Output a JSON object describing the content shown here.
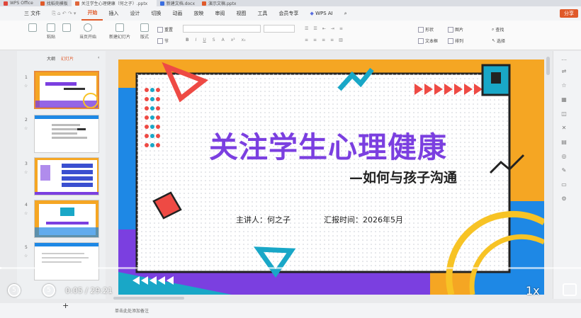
{
  "titlebar": {
    "tabs": [
      {
        "label": "WPS Office",
        "color": "#e0463a"
      },
      {
        "label": "找稻壳模板",
        "color": "#e05a2a"
      },
      {
        "label": "关注学生心理健康（何之子）.pptx",
        "color": "#e0663a"
      },
      {
        "label": "新建文档.docx",
        "color": "#3a6ee0"
      },
      {
        "label": "演示文稿.pptx",
        "color": "#e05a2a"
      }
    ]
  },
  "menu": {
    "file": "三 文件",
    "items": [
      "开始",
      "插入",
      "设计",
      "切换",
      "动画",
      "放映",
      "审阅",
      "视图",
      "工具",
      "会员专享"
    ],
    "wps_ai": "WPS AI",
    "share": "分享"
  },
  "ribbon": {
    "paste": "粘贴",
    "play_from": "当页开始",
    "new_slide": "新建幻灯片",
    "layout": "版式",
    "section": "节",
    "reset": "重置",
    "shape": "形状",
    "picture": "图片",
    "textbox": "文本框",
    "arrange": "排列",
    "find": "查找",
    "select": "选择"
  },
  "panel": {
    "outline": "大纲",
    "slides": "幻灯片",
    "slide_numbers": [
      "1",
      "2",
      "3",
      "4",
      "5"
    ]
  },
  "slide": {
    "title": "关注学生心理健康",
    "subtitle": "—如何与孩子沟通",
    "presenter": "主讲人：何之子",
    "report_time": "汇报时间：2026年5月",
    "colors": {
      "orange": "#f5a623",
      "blue": "#1e88e5",
      "purple": "#7b3fe0",
      "red": "#ee4a44",
      "cyan": "#19a7c7",
      "yellow": "#f7c325"
    }
  },
  "status": {
    "note": "单击此处添加备注"
  },
  "video": {
    "time": "0:05 / 29:21",
    "speed": "1x",
    "rewind": "5",
    "forward": "5",
    "progress": 0.003
  }
}
